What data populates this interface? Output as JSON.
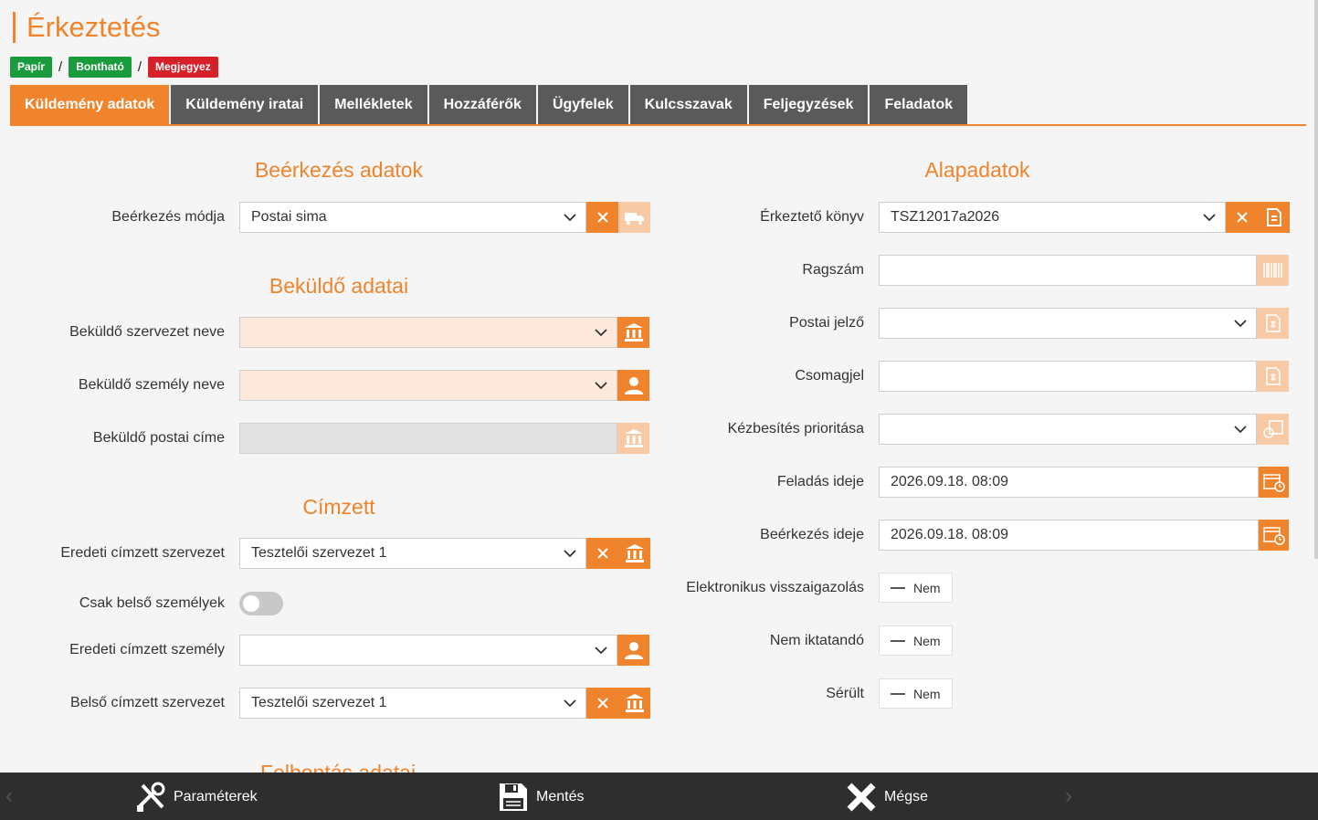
{
  "page_title": "Érkeztetés",
  "badges": [
    {
      "label": "Papír",
      "color": "#1a9c3e"
    },
    {
      "label": "Bontható",
      "color": "#1a9c3e"
    },
    {
      "label": "Megjegyez",
      "color": "#d6202a"
    }
  ],
  "badge_separator": "/",
  "tabs": [
    {
      "label": "Küldemény adatok",
      "active": true
    },
    {
      "label": "Küldemény iratai"
    },
    {
      "label": "Mellékletek"
    },
    {
      "label": "Hozzáférők"
    },
    {
      "label": "Ügyfelek"
    },
    {
      "label": "Kulcsszavak"
    },
    {
      "label": "Feljegyzések"
    },
    {
      "label": "Feladatok"
    }
  ],
  "left": {
    "sections": {
      "arrival": "Beérkezés adatok",
      "sender": "Beküldő adatai",
      "recipient": "Címzett",
      "opening": "Felbontás adatai"
    },
    "fields": {
      "arrival_mode": {
        "label": "Beérkezés módja",
        "value": "Postai sima"
      },
      "sender_org": {
        "label": "Beküldő szervezet neve",
        "value": ""
      },
      "sender_person": {
        "label": "Beküldő személy neve",
        "value": ""
      },
      "sender_address": {
        "label": "Beküldő postai címe",
        "value": ""
      },
      "orig_recipient_org": {
        "label": "Eredeti címzett szervezet",
        "value": "Tesztelői szervezet 1"
      },
      "internal_only": {
        "label": "Csak belső személyek",
        "value": false
      },
      "orig_recipient_person": {
        "label": "Eredeti címzett személy",
        "value": ""
      },
      "internal_recipient_org": {
        "label": "Belső címzett szervezet",
        "value": "Tesztelői szervezet 1"
      }
    }
  },
  "right": {
    "section": "Alapadatok",
    "fields": {
      "register_book": {
        "label": "Érkeztető könyv",
        "value": "TSZ12017a2026"
      },
      "label_number": {
        "label": "Ragszám",
        "value": ""
      },
      "postal_mark": {
        "label": "Postai jelző",
        "value": ""
      },
      "package_mark": {
        "label": "Csomagjel",
        "value": ""
      },
      "delivery_priority": {
        "label": "Kézbesítés prioritása",
        "value": ""
      },
      "sent_time": {
        "label": "Feladás ideje",
        "value": "2026.09.18. 08:09"
      },
      "arrival_time": {
        "label": "Beérkezés ideje",
        "value": "2026.09.18. 08:09"
      },
      "e_confirmation": {
        "label": "Elektronikus visszaigazolás",
        "value": "Nem"
      },
      "not_registered": {
        "label": "Nem iktatandó",
        "value": "Nem"
      },
      "damaged": {
        "label": "Sérült",
        "value": "Nem"
      }
    }
  },
  "footer": {
    "parameters": "Paraméterek",
    "save": "Mentés",
    "cancel": "Mégse"
  },
  "colors": {
    "accent": "#f0842c",
    "accent_light": "#f7c9a5",
    "tab_bg": "#5a5a5a",
    "footer_bg": "#2e2e2e"
  }
}
